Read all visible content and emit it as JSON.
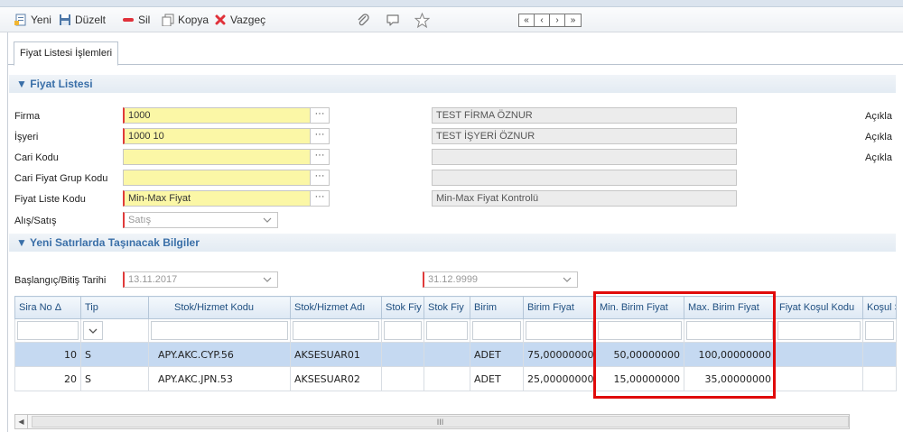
{
  "toolbar": {
    "new_label": "Yeni",
    "edit_label": "Düzelt",
    "delete_label": "Sil",
    "copy_label": "Kopya",
    "cancel_label": "Vazgeç",
    "nav": [
      "«",
      "‹",
      "›",
      "»"
    ]
  },
  "tabs": [
    {
      "label": "Fiyat Listesi İşlemleri"
    }
  ],
  "section1": {
    "title": "Fiyat Listesi"
  },
  "section2": {
    "title": "Yeni Satırlarda Taşınacak Bilgiler"
  },
  "form": {
    "firma": {
      "label": "Firma",
      "value": "1000",
      "desc": "TEST FİRMA ÖZNUR"
    },
    "isyeri": {
      "label": "İşyeri",
      "value": "1000 10",
      "desc": "TEST İŞYERİ ÖZNUR"
    },
    "cari_kodu": {
      "label": "Cari Kodu",
      "value": "",
      "desc": ""
    },
    "cari_fiyat_grup": {
      "label": "Cari Fiyat Grup Kodu",
      "value": "",
      "desc": ""
    },
    "fiyat_liste_kodu": {
      "label": "Fiyat Liste Kodu",
      "value": "Min-Max Fiyat",
      "desc": "Min-Max Fiyat Kontrolü"
    },
    "alis_satis": {
      "label": "Alış/Satış",
      "value": "Satış"
    },
    "aciklama_labels": [
      "Açıkla",
      "Açıkla",
      "Açıkla"
    ],
    "tarih": {
      "label": "Başlangıç/Bitiş Tarihi",
      "start": "13.11.2017",
      "end": "31.12.9999"
    }
  },
  "grid": {
    "columns": [
      "Sira No",
      "Tip",
      "Stok/Hizmet Kodu",
      "Stok/Hizmet Adı",
      "Stok Fiy",
      "Stok Fiy",
      "Birim",
      "Birim Fiyat",
      "Min. Birim Fiyat",
      "Max. Birim Fiyat",
      "Fiyat Koşul Kodu",
      "Koşul Sı"
    ],
    "sort_indicator": "Δ",
    "rows": [
      {
        "sira": "10",
        "tip": "S",
        "kod": "APY.AKC.CYP.56",
        "ad": "AKSESUAR01",
        "f1": "",
        "f2": "",
        "birim": "ADET",
        "birim_fiyat": "75,00000000",
        "min": "50,00000000",
        "max": "100,00000000",
        "kosul": "",
        "kosul_s": ""
      },
      {
        "sira": "20",
        "tip": "S",
        "kod": "APY.AKC.JPN.53",
        "ad": "AKSESUAR02",
        "f1": "",
        "f2": "",
        "birim": "ADET",
        "birim_fiyat": "25,00000000",
        "min": "15,00000000",
        "max": "35,00000000",
        "kosul": "",
        "kosul_s": ""
      }
    ]
  },
  "scrollbar": {
    "thumb": "III"
  }
}
